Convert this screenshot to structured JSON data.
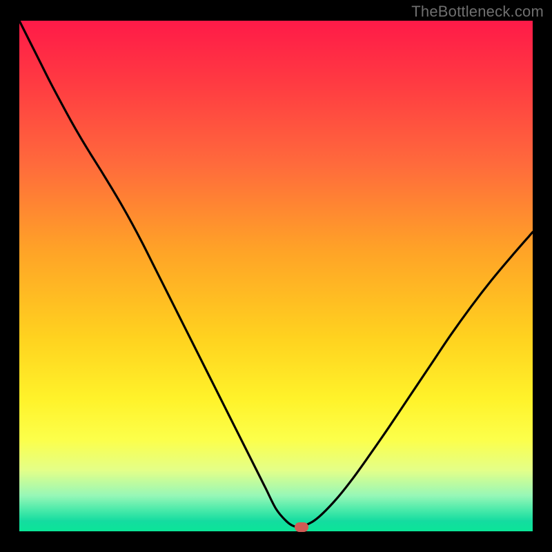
{
  "watermark": "TheBottleneck.com",
  "colors": {
    "frame": "#000000",
    "watermark": "#6f6f6f",
    "curve": "#000000",
    "marker": "#d05a54",
    "gradient_stops": [
      "#ff1a48",
      "#ff3a42",
      "#ff6a3c",
      "#ffa327",
      "#ffd21f",
      "#fff22a",
      "#fcff4a",
      "#e4ff88",
      "#97f7b7",
      "#45e9a9",
      "#14dca0",
      "#0be598"
    ]
  },
  "chart_data": {
    "type": "line",
    "title": "",
    "xlabel": "",
    "ylabel": "",
    "categories": [],
    "x": [
      0.0,
      0.02,
      0.04,
      0.06,
      0.08,
      0.1,
      0.12,
      0.14,
      0.16,
      0.18,
      0.2,
      0.22,
      0.24,
      0.26,
      0.28,
      0.3,
      0.32,
      0.34,
      0.36,
      0.38,
      0.4,
      0.42,
      0.44,
      0.46,
      0.48,
      0.5,
      0.52,
      0.535,
      0.55,
      0.57,
      0.59,
      0.62,
      0.65,
      0.68,
      0.72,
      0.76,
      0.8,
      0.84,
      0.88,
      0.92,
      0.96,
      1.0
    ],
    "values": [
      1.0,
      0.96,
      0.92,
      0.88,
      0.842,
      0.805,
      0.77,
      0.737,
      0.705,
      0.672,
      0.638,
      0.602,
      0.564,
      0.524,
      0.484,
      0.444,
      0.404,
      0.364,
      0.324,
      0.284,
      0.244,
      0.204,
      0.164,
      0.124,
      0.084,
      0.044,
      0.02,
      0.01,
      0.01,
      0.018,
      0.034,
      0.066,
      0.104,
      0.146,
      0.204,
      0.264,
      0.324,
      0.384,
      0.44,
      0.492,
      0.54,
      0.586
    ],
    "xlim": [
      0,
      1
    ],
    "ylim": [
      0,
      1
    ],
    "marker": {
      "x": 0.55,
      "y": 0.008
    },
    "description": "V-shaped bottleneck curve: steep descent from top-left, minimum around x≈0.55 at the bottom edge, then a gentler rise toward the right edge."
  }
}
